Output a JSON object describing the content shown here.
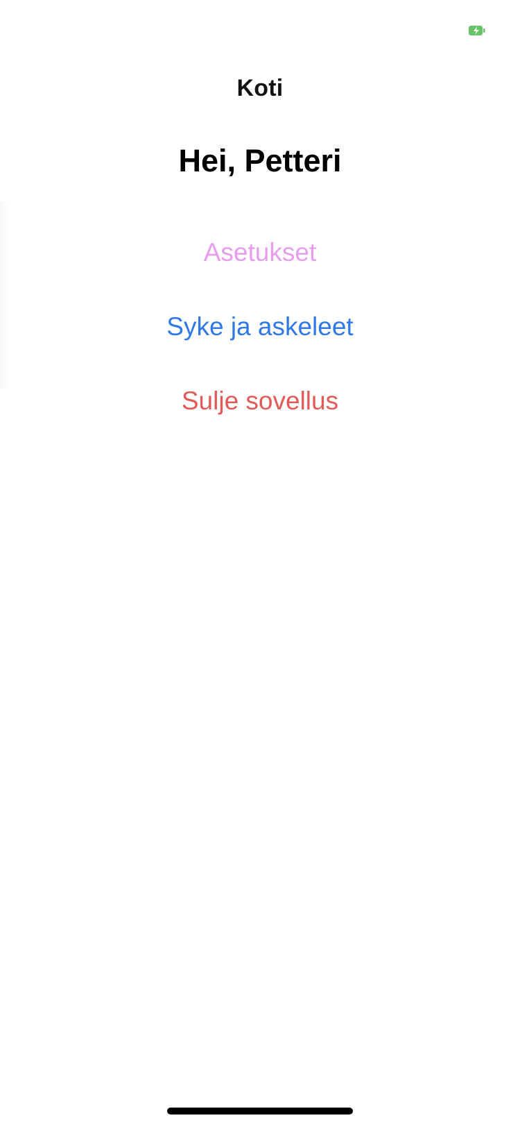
{
  "status_bar": {
    "battery_icon": "battery-charging-icon",
    "battery_color": "#65c466"
  },
  "nav": {
    "title": "Koti"
  },
  "greeting": "Hei, Petteri",
  "menu": {
    "settings_label": "Asetukset",
    "settings_color": "#e79cf0",
    "health_label": "Syke ja askeleet",
    "health_color": "#2f78e5",
    "close_label": "Sulje sovellus",
    "close_color": "#e05a57"
  }
}
